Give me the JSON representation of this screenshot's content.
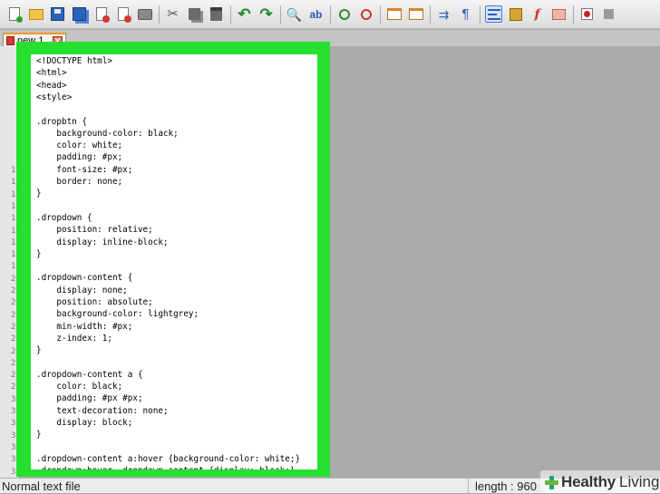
{
  "toolbar": {
    "buttons": [
      {
        "name": "new-file-icon",
        "glyph": ""
      },
      {
        "name": "open-folder-icon",
        "glyph": ""
      },
      {
        "name": "save-icon",
        "glyph": ""
      },
      {
        "name": "save-all-icon",
        "glyph": ""
      },
      {
        "name": "close-file-icon",
        "glyph": ""
      },
      {
        "name": "close-all-icon",
        "glyph": ""
      },
      {
        "name": "print-icon",
        "glyph": ""
      },
      {
        "name": "cut-icon",
        "glyph": "✂"
      },
      {
        "name": "copy-icon",
        "glyph": ""
      },
      {
        "name": "paste-icon",
        "glyph": ""
      },
      {
        "name": "undo-icon",
        "glyph": "↶"
      },
      {
        "name": "redo-icon",
        "glyph": "↷"
      },
      {
        "name": "find-icon",
        "glyph": "🔍"
      },
      {
        "name": "replace-icon",
        "glyph": "ab"
      },
      {
        "name": "zoom-in-icon",
        "glyph": ""
      },
      {
        "name": "zoom-out-icon",
        "glyph": ""
      },
      {
        "name": "sync-vertical-icon",
        "glyph": ""
      },
      {
        "name": "sync-horizontal-icon",
        "glyph": ""
      },
      {
        "name": "word-wrap-icon",
        "glyph": "⇉"
      },
      {
        "name": "show-all-characters-icon",
        "glyph": "¶"
      },
      {
        "name": "indent-guide-icon",
        "glyph": ""
      },
      {
        "name": "document-map-icon",
        "glyph": ""
      },
      {
        "name": "function-list-icon",
        "glyph": "f"
      },
      {
        "name": "folder-as-workspace-icon",
        "glyph": ""
      },
      {
        "name": "record-macro-icon",
        "glyph": ""
      },
      {
        "name": "stop-recording-icon",
        "glyph": ""
      }
    ]
  },
  "tab": {
    "label": "new 1",
    "close_glyph": "✕"
  },
  "gutter": {
    "line_numbers": [
      "1",
      "1",
      "1",
      "1",
      "1",
      "1",
      "1",
      "1",
      "1",
      "2",
      "2",
      "2",
      "2",
      "2",
      "2",
      "2",
      "2",
      "2",
      "2",
      "3",
      "3",
      "3",
      "3",
      "3",
      "3",
      "3",
      "3"
    ]
  },
  "code": {
    "lines": [
      "<!DOCTYPE html>",
      "<html>",
      "<head>",
      "<style>",
      "",
      ".dropbtn {",
      "    background-color: black;",
      "    color: white;",
      "    padding: #px;",
      "    font-size: #px;",
      "    border: none;",
      "}",
      "",
      ".dropdown {",
      "    position: relative;",
      "    display: inline-block;",
      "}",
      "",
      ".dropdown-content {",
      "    display: none;",
      "    position: absolute;",
      "    background-color: lightgrey;",
      "    min-width: #px;",
      "    z-index: 1;",
      "}",
      "",
      ".dropdown-content a {",
      "    color: black;",
      "    padding: #px #px;",
      "    text-decoration: none;",
      "    display: block;",
      "}",
      "",
      ".dropdown-content a:hover {background-color: white;}",
      ".dropdown:hover .dropdown-content {display: block;}"
    ]
  },
  "status": {
    "file_type": "Normal text file",
    "length": "length : 960"
  },
  "watermark": {
    "brand_bold": "Healthy",
    "brand_rest": "Living"
  },
  "colors": {
    "highlight": "#25e02e",
    "tab_accent": "#f19a28"
  }
}
